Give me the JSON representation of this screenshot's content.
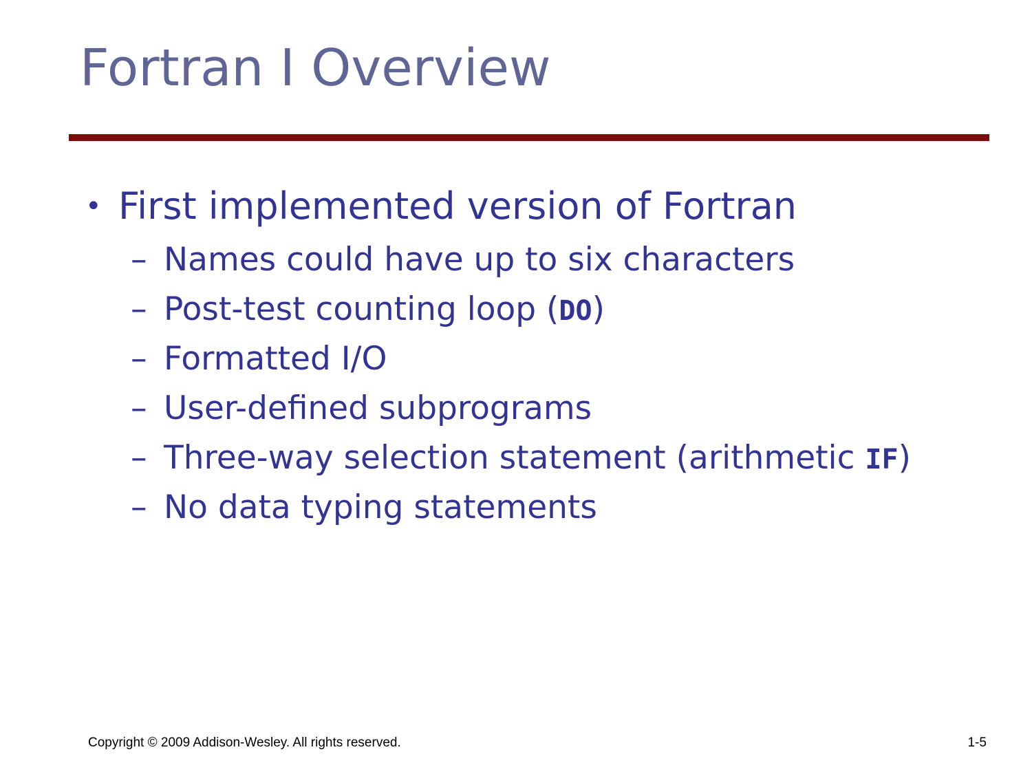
{
  "slide": {
    "title": "Fortran I Overview",
    "bullet": {
      "marker": "•",
      "text": "First implemented version of Fortran"
    },
    "sub_items": [
      {
        "dash": "–",
        "before": "Names could have up to six characters",
        "code": "",
        "after": ""
      },
      {
        "dash": "–",
        "before": "Post-test counting loop (",
        "code": "DO",
        "after": ")"
      },
      {
        "dash": "–",
        "before": "Formatted I/O",
        "code": "",
        "after": ""
      },
      {
        "dash": "–",
        "before": "User-defined subprograms",
        "code": "",
        "after": ""
      },
      {
        "dash": "–",
        "before": "Three-way selection statement (arithmetic ",
        "code": "IF",
        "after": ")"
      },
      {
        "dash": "–",
        "before": "No data typing statements",
        "code": "",
        "after": ""
      }
    ],
    "footer": {
      "copyright": "Copyright © 2009 Addison-Wesley. All rights reserved.",
      "page_number": "1-5"
    },
    "colors": {
      "title": "#5f6696",
      "body_text": "#323494",
      "rule": "#7a0c0c",
      "background": "#ffffff"
    }
  }
}
